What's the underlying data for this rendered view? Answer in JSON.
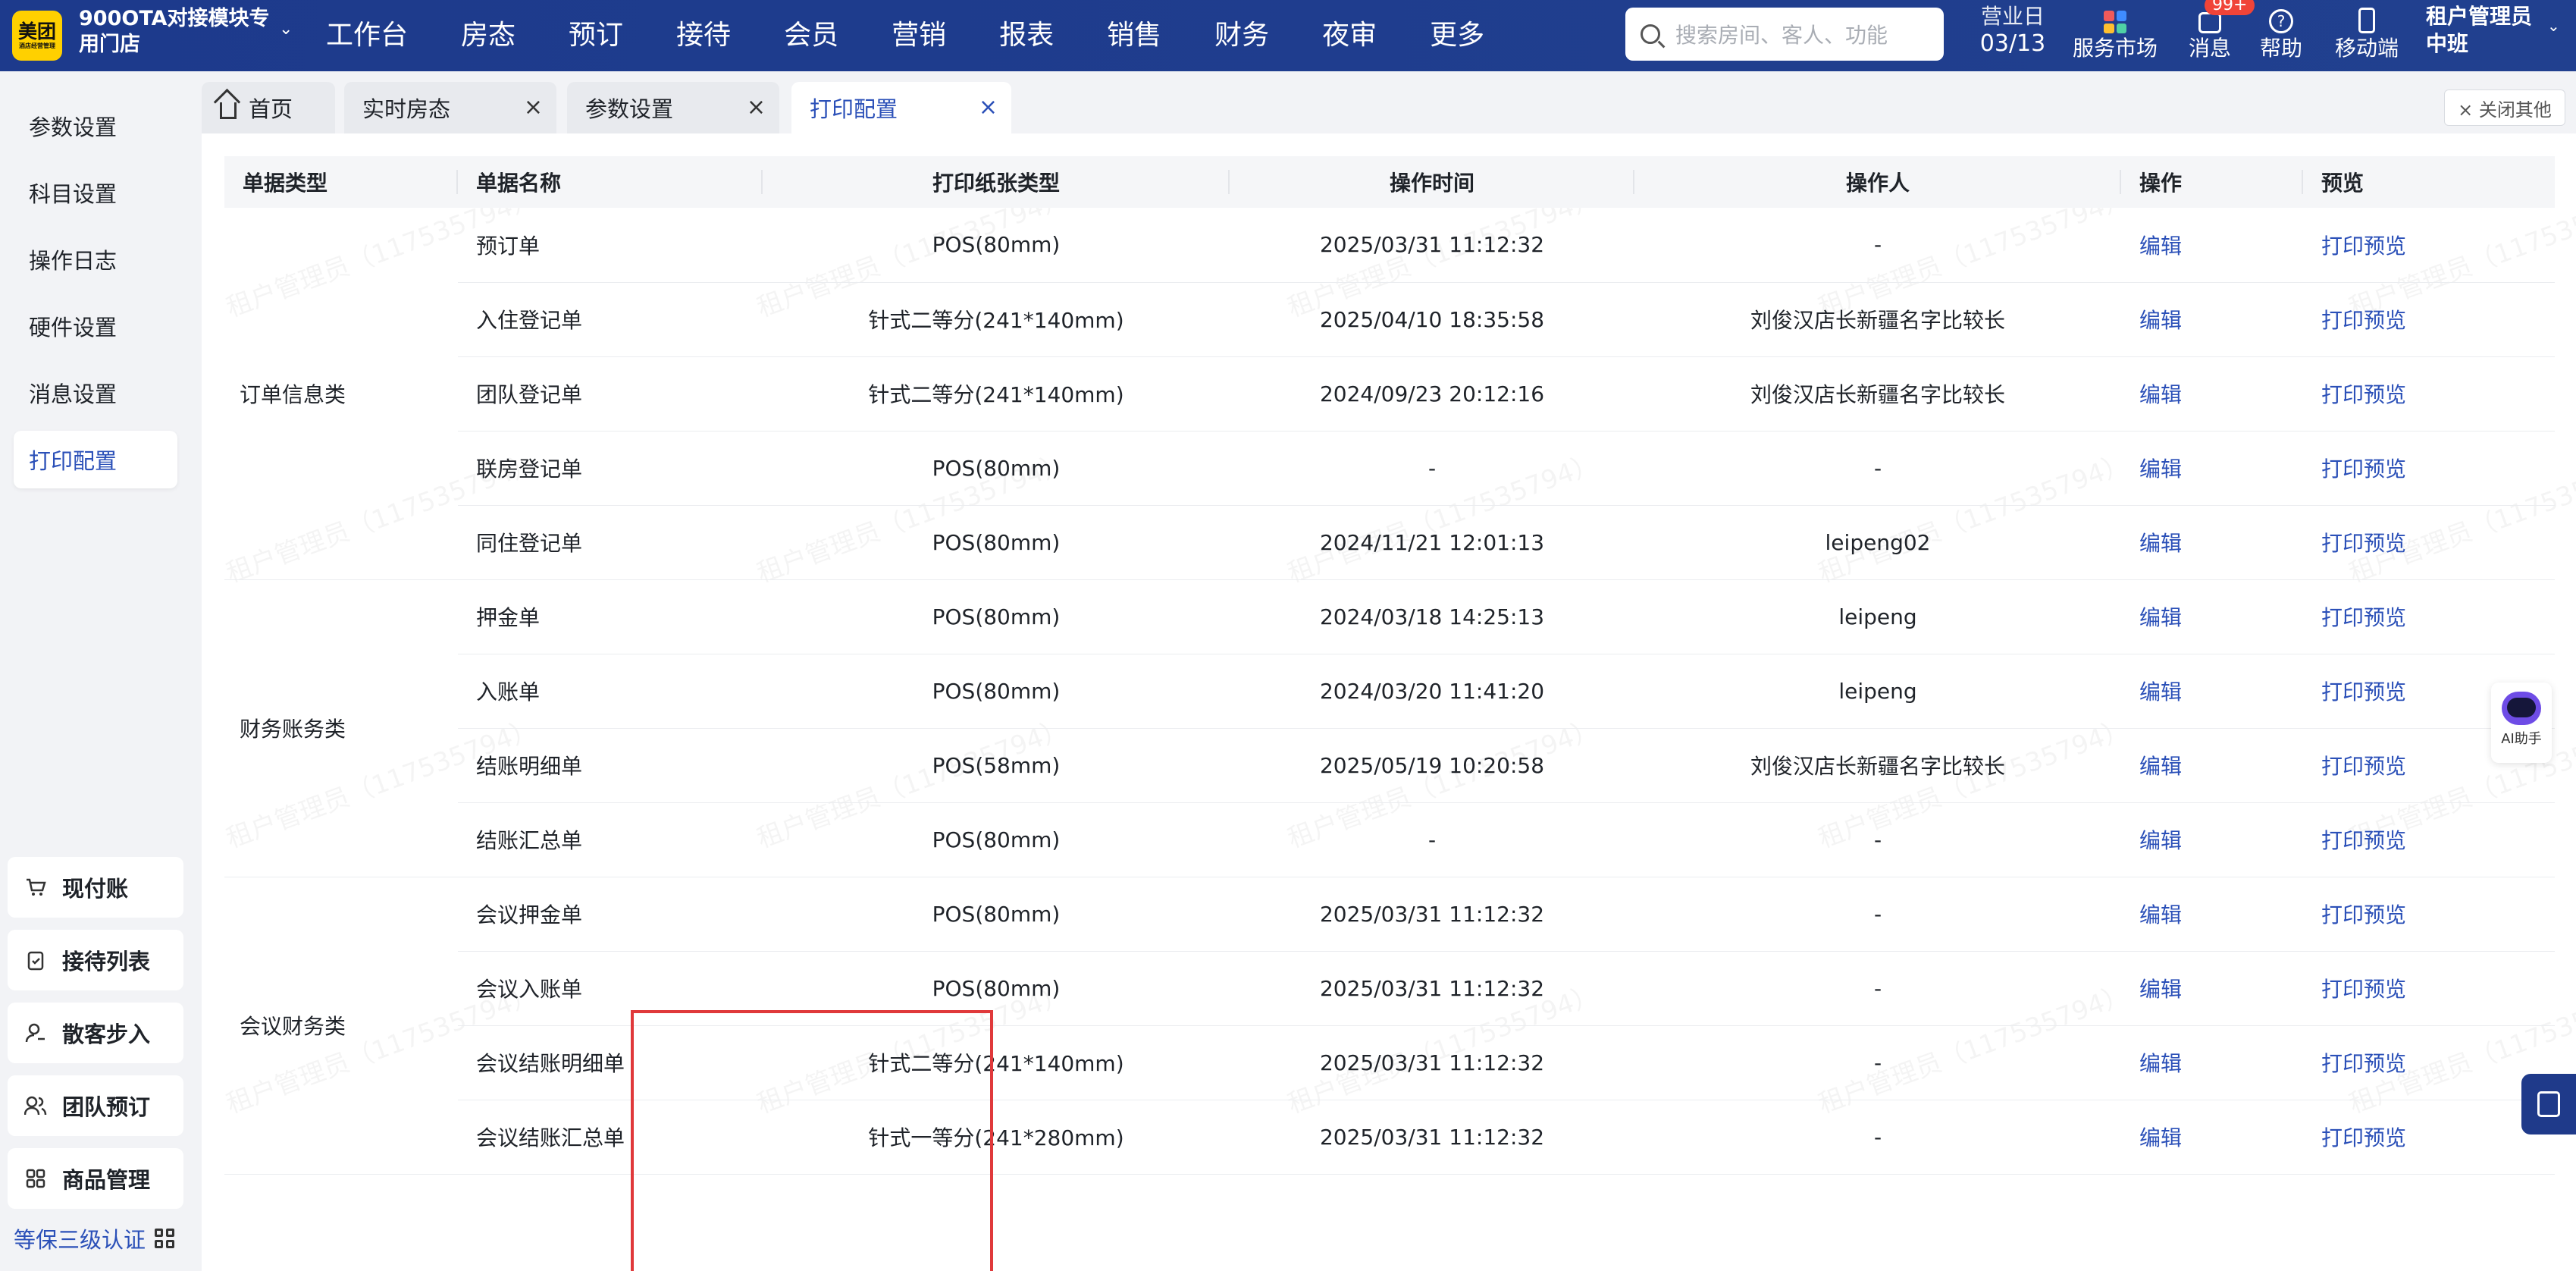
{
  "topbar": {
    "logo": {
      "main": "美团",
      "sub": "酒店经营管理"
    },
    "store_name": "900OTA对接模块专用门店",
    "nav": [
      "工作台",
      "房态",
      "预订",
      "接待",
      "会员",
      "营销",
      "报表",
      "销售",
      "财务",
      "夜审",
      "更多"
    ],
    "search_placeholder": "搜索房间、客人、功能",
    "business_day_label": "营业日",
    "business_day_value": "03/13",
    "service_market": "服务市场",
    "messages": "消息",
    "messages_badge": "99+",
    "help": "帮助",
    "mobile": "移动端",
    "user_name": "租户管理员",
    "user_shift": "中班"
  },
  "sidebar": {
    "items": [
      "参数设置",
      "科目设置",
      "操作日志",
      "硬件设置",
      "消息设置",
      "打印配置"
    ],
    "active": "打印配置",
    "quick": [
      "现付账",
      "接待列表",
      "散客步入",
      "团队预订",
      "商品管理"
    ],
    "cert": "等保三级认证"
  },
  "tabs": [
    {
      "label": "首页"
    },
    {
      "label": "实时房态"
    },
    {
      "label": "参数设置"
    },
    {
      "label": "打印配置"
    }
  ],
  "close_others": "× 关闭其他",
  "table": {
    "headers": [
      "单据类型",
      "单据名称",
      "打印纸张类型",
      "操作时间",
      "操作人",
      "操作",
      "预览"
    ],
    "edit_label": "编辑",
    "preview_label": "打印预览",
    "groups": [
      {
        "category": "订单信息类",
        "rows": [
          {
            "name": "预订单",
            "paper": "POS(80mm)",
            "time": "2025/03/31 11:12:32",
            "operator": "-"
          },
          {
            "name": "入住登记单",
            "paper": "针式二等分(241*140mm)",
            "time": "2025/04/10 18:35:58",
            "operator": "刘俊汉店长新疆名字比较长"
          },
          {
            "name": "团队登记单",
            "paper": "针式二等分(241*140mm)",
            "time": "2024/09/23 20:12:16",
            "operator": "刘俊汉店长新疆名字比较长"
          },
          {
            "name": "联房登记单",
            "paper": "POS(80mm)",
            "time": "-",
            "operator": "-"
          },
          {
            "name": "同住登记单",
            "paper": "POS(80mm)",
            "time": "2024/11/21 12:01:13",
            "operator": "leipeng02"
          }
        ]
      },
      {
        "category": "财务账务类",
        "rows": [
          {
            "name": "押金单",
            "paper": "POS(80mm)",
            "time": "2024/03/18 14:25:13",
            "operator": "leipeng"
          },
          {
            "name": "入账单",
            "paper": "POS(80mm)",
            "time": "2024/03/20 11:41:20",
            "operator": "leipeng"
          },
          {
            "name": "结账明细单",
            "paper": "POS(58mm)",
            "time": "2025/05/19 10:20:58",
            "operator": "刘俊汉店长新疆名字比较长"
          },
          {
            "name": "结账汇总单",
            "paper": "POS(80mm)",
            "time": "-",
            "operator": "-"
          }
        ]
      },
      {
        "category": "会议财务类",
        "rows": [
          {
            "name": "会议押金单",
            "paper": "POS(80mm)",
            "time": "2025/03/31 11:12:32",
            "operator": "-"
          },
          {
            "name": "会议入账单",
            "paper": "POS(80mm)",
            "time": "2025/03/31 11:12:32",
            "operator": "-"
          },
          {
            "name": "会议结账明细单",
            "paper": "针式二等分(241*140mm)",
            "time": "2025/03/31 11:12:32",
            "operator": "-"
          },
          {
            "name": "会议结账汇总单",
            "paper": "针式一等分(241*280mm)",
            "time": "2025/03/31 11:12:32",
            "operator": "-"
          }
        ]
      }
    ]
  },
  "watermark": "租户管理员（117535794）",
  "ai_label": "AI助手",
  "colors": {
    "topbar": "#1f3a8a",
    "link": "#2b50b8",
    "highlight": "#e0393b",
    "badge": "#f04438"
  }
}
